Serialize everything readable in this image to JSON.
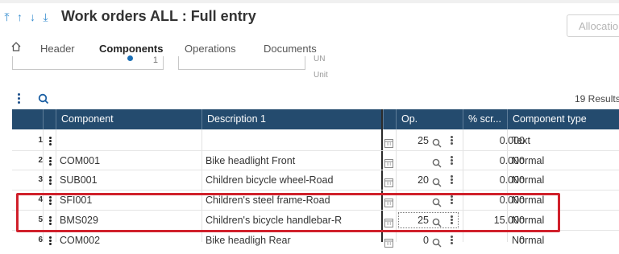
{
  "title": "Work orders ALL : Full entry",
  "allocation_button": "Allocatio",
  "tabs": [
    {
      "label": "Header"
    },
    {
      "label": "Components"
    },
    {
      "label": "Operations"
    },
    {
      "label": "Documents"
    }
  ],
  "form": {
    "quantity_value": "1",
    "unit_value": "UN",
    "unit_label": "Unit"
  },
  "results_text": "19 Results",
  "columns": {
    "component": "Component",
    "description": "Description 1",
    "op": "Op.",
    "scrap": "% scr...",
    "component_type": "Component type"
  },
  "rows": [
    {
      "num": "1",
      "component": "",
      "description": "",
      "op": "25",
      "scrap": "0.000",
      "type": "Text"
    },
    {
      "num": "2",
      "component": "COM001",
      "description": "Bike headlight Front",
      "op": "",
      "scrap": "0.000",
      "type": "Normal"
    },
    {
      "num": "3",
      "component": "SUB001",
      "description": "Children bicycle wheel-Road",
      "op": "20",
      "scrap": "0.000",
      "type": "Normal"
    },
    {
      "num": "4",
      "component": "SFI001",
      "description": "Children's steel frame-Road",
      "op": "",
      "scrap": "0.000",
      "type": "Normal"
    },
    {
      "num": "5",
      "component": "BMS029",
      "description": "Children's bicycle handlebar-R",
      "op": "25",
      "scrap": "15.000",
      "type": "Normal"
    },
    {
      "num": "6",
      "component": "COM002",
      "description": "Bike headligh Rear",
      "op": "0",
      "scrap": "0",
      "type": "Normal"
    }
  ],
  "colors": {
    "header_bg": "#244b6e",
    "accent": "#1b6fb5",
    "highlight": "#d0202b"
  }
}
